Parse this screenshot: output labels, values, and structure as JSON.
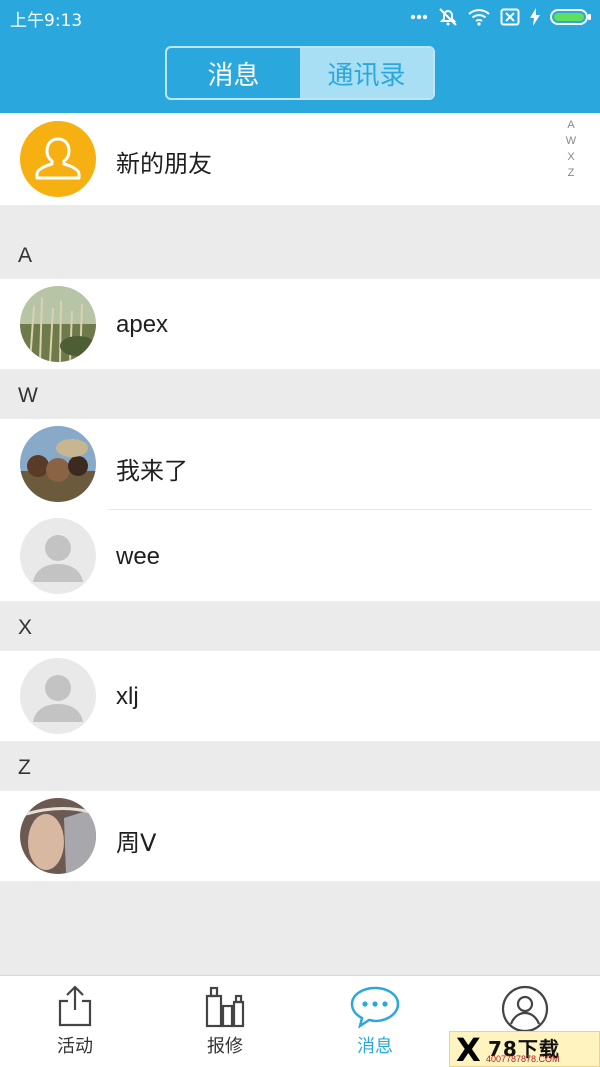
{
  "status_bar": {
    "time": "上午9:13"
  },
  "header": {
    "tabs": [
      {
        "label": "消息",
        "active": false
      },
      {
        "label": "通讯录",
        "active": true
      }
    ]
  },
  "new_friends": {
    "label": "新的朋友",
    "icon": "user-outline-icon",
    "icon_color": "#f7b012"
  },
  "index_letters": [
    "A",
    "W",
    "X",
    "Z"
  ],
  "sections": [
    {
      "letter": "A",
      "contacts": [
        {
          "name": "apex",
          "avatar": "photo-grass"
        }
      ]
    },
    {
      "letter": "W",
      "contacts": [
        {
          "name": "我来了",
          "avatar": "photo-group"
        },
        {
          "name": "wee",
          "avatar": "default-avatar"
        }
      ]
    },
    {
      "letter": "X",
      "contacts": [
        {
          "name": "xlj",
          "avatar": "default-avatar"
        }
      ]
    },
    {
      "letter": "Z",
      "contacts": [
        {
          "name": "周V",
          "avatar": "photo-wolf"
        }
      ]
    }
  ],
  "tabbar": {
    "items": [
      {
        "label": "活动",
        "icon": "share-icon",
        "active": false
      },
      {
        "label": "报修",
        "icon": "tools-icon",
        "active": false
      },
      {
        "label": "消息",
        "icon": "chat-bubble-icon",
        "active": true
      },
      {
        "label": "",
        "icon": "profile-icon",
        "active": false
      }
    ]
  },
  "watermark": {
    "brand": "78下载",
    "site": "4007787878.COM"
  },
  "colors": {
    "primary": "#2aa8dd",
    "background": "#ebebeb",
    "accent": "#f7b012"
  }
}
